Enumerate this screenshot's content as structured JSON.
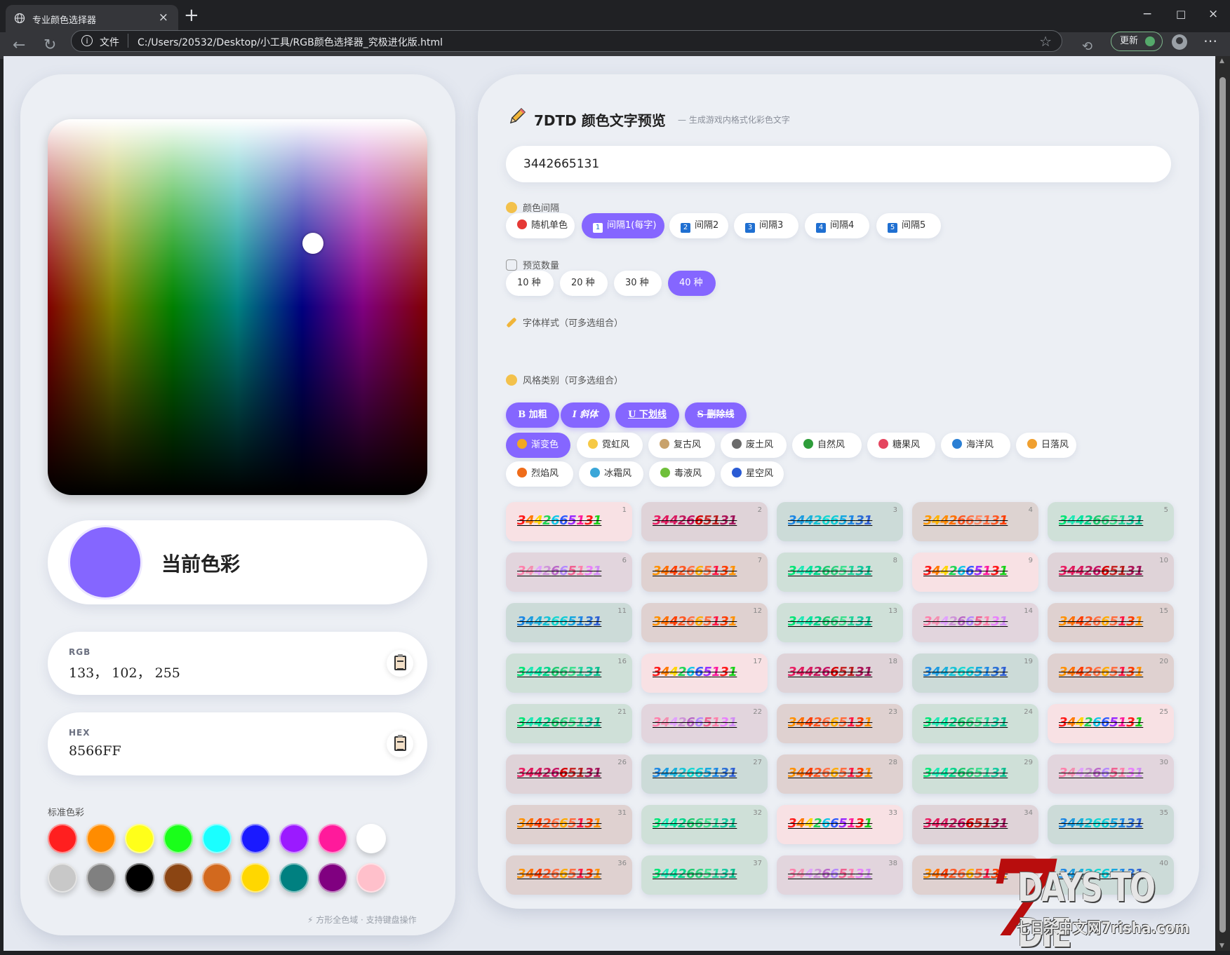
{
  "browser": {
    "tab_title": "专业颜色选择器",
    "tab_close": "×",
    "new_tab": "+",
    "url_scheme": "文件",
    "url_path": "C:/Users/20532/Desktop/小工具/RGB颜色选择器_究极进化版.html",
    "update_label": "更新",
    "controls": {
      "minimize": "−",
      "maximize": "□",
      "close": "×"
    },
    "more": "⋯"
  },
  "left": {
    "current_label": "当前色彩",
    "current_color": "#8566ff",
    "rgb_caption": "RGB",
    "rgb_value": "133， 102， 255",
    "hex_caption": "HEX",
    "hex_value": "8566FF",
    "standard_label": "标准色彩",
    "swatches": [
      "#ff1f1f",
      "#ff8c00",
      "#ffff1a",
      "#1aff1a",
      "#1affff",
      "#1a1aff",
      "#9b1aff",
      "#ff1a9b",
      "#ffffff",
      "#c8c8c8",
      "#808080",
      "#000000",
      "#8b4513",
      "#d2691e",
      "#ffd700",
      "#008080",
      "#800080",
      "#ffc0cb"
    ],
    "footer": "⚡ 方形全色域 · 支持键盘操作"
  },
  "right": {
    "title": "7DTD 颜色文字预览",
    "subtitle": "— 生成游戏内格式化彩色文字",
    "input_value": "3442665131",
    "interval_label": "颜色间隔",
    "intervals": [
      "随机单色",
      "间隔1(每字)",
      "间隔2",
      "间隔3",
      "间隔4",
      "间隔5"
    ],
    "interval_active": 1,
    "count_label": "预览数量",
    "counts": [
      "10 种",
      "20 种",
      "30 种",
      "40 种"
    ],
    "count_active": 3,
    "font_label": "字体样式（可多选组合）",
    "font_styles": [
      "B 加粗",
      "I 斜体",
      "U 下划线",
      "S 删除线"
    ],
    "style_label": "风格类别（可多选组合）",
    "styles": [
      "渐变色",
      "霓虹风",
      "复古风",
      "废土风",
      "自然风",
      "糖果风",
      "海洋风",
      "日落风",
      "烈焰风",
      "冰霜风",
      "毒液风",
      "星空风"
    ],
    "style_active": 0,
    "preview_text": "3442665131",
    "preview_themes": [
      "rainbow",
      "magenta",
      "ocean",
      "sunset",
      "mint",
      "pastel",
      "fire",
      "mint",
      "rainbow",
      "magenta",
      "ocean",
      "fire",
      "mint",
      "pastel",
      "fire",
      "mint",
      "rainbow",
      "magenta",
      "ocean",
      "fire",
      "mint",
      "pastel",
      "fire",
      "mint",
      "rainbow",
      "magenta",
      "ocean",
      "fire",
      "mint",
      "pastel",
      "fire",
      "mint",
      "rainbow",
      "magenta",
      "ocean",
      "fire",
      "mint",
      "pastel",
      "fire",
      "ocean"
    ]
  },
  "watermark": {
    "seven": "7",
    "days": "DAYS TO DIE",
    "site": "七日杀中文网7risha.com"
  }
}
